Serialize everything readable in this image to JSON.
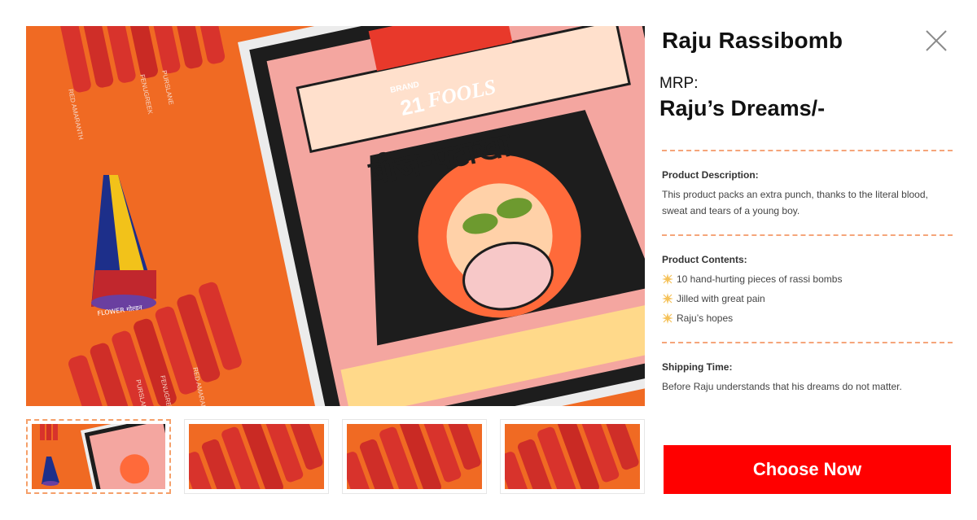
{
  "product": {
    "title": "Raju Rassibomb",
    "mrp_label": "MRP:",
    "price": "Raju’s Dreams/-"
  },
  "gallery": {
    "box_text": {
      "brand": "BRAND",
      "number": "21",
      "fools": "FOOLS",
      "hindi_title": "बीज-पटाखा"
    },
    "stick_labels": [
      "RED AMARANTH",
      "FENUGREEK",
      "PURSLANE",
      "RED AMARANTH",
      "FENUGREEK",
      "PURSLANE"
    ],
    "cone_label": "FLOWER गोल्डन",
    "thumbnails_count": 4,
    "active_thumbnail": 1
  },
  "description": {
    "heading": "Product Description:",
    "text": "This product packs an extra punch, thanks to the literal blood, sweat and tears of a young boy."
  },
  "contents": {
    "heading": "Product Contents:",
    "items": [
      {
        "label": "10 hand-hurting pieces of rassi bombs",
        "icon": "sparkle-icon"
      },
      {
        "label": "Jilled with great pain",
        "icon": "sparkle-icon"
      },
      {
        "label": "Raju’s hopes",
        "icon": "sparkle-icon"
      }
    ]
  },
  "shipping": {
    "heading": "Shipping Time:",
    "text": "Before Raju understands that his dreams do not matter."
  },
  "cta": {
    "label": "Choose Now",
    "color": "#ff0000"
  },
  "colors": {
    "accent_orange": "#f06a23",
    "divider": "#f5a57a",
    "stick_red": "#d8332c"
  }
}
